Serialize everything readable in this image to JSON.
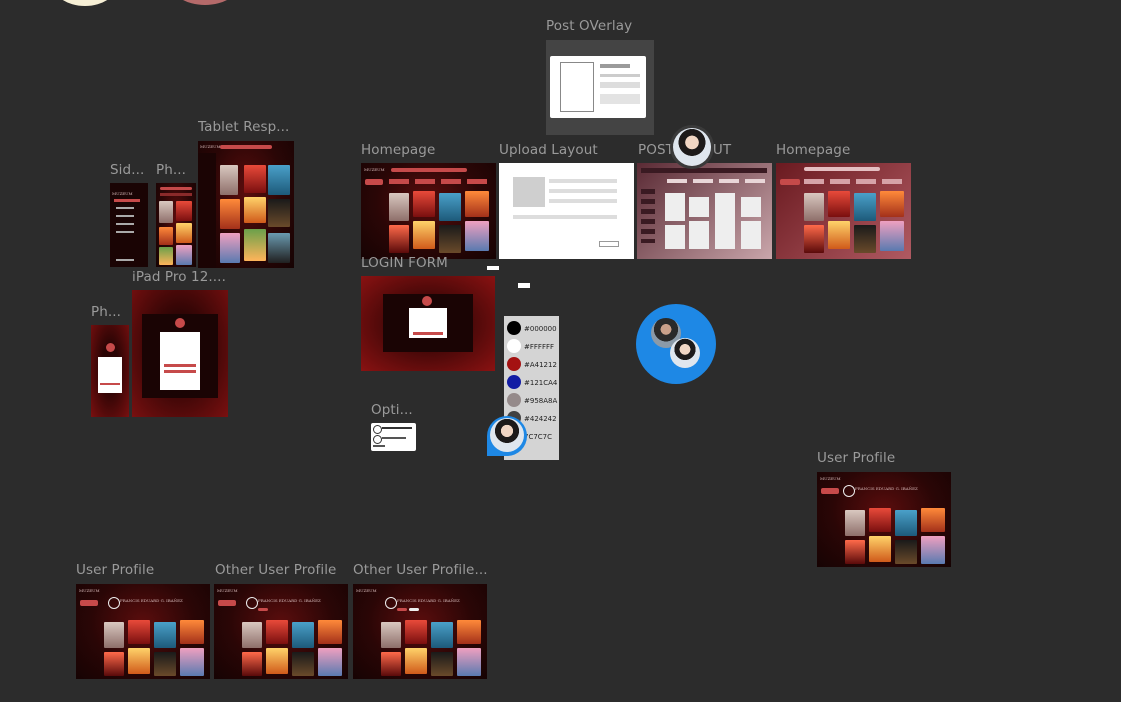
{
  "colors": {
    "canvas": "#2c2c2c",
    "frame_red_dark": "#2a0606",
    "accent": "#c64a4a",
    "label": "#9a9a9a",
    "multiplayer_blue": "#1e88e5"
  },
  "frames": {
    "post_overlay": "Post OVerlay",
    "tablet": "Tablet Resp...",
    "sidebar": "Sid...",
    "phone1": "Ph...",
    "homepage1": "Homepage",
    "upload_layout": "Upload Layout",
    "post_layout": "POST LAYOUT",
    "homepage2": "Homepage",
    "login_form": "LOGIN FORM",
    "ipad": "iPad Pro 12....",
    "phone2": "Ph...",
    "options": "Opti...",
    "user_profile_right": "User Profile",
    "user_profile_bottom": "User Profile",
    "other_user_profile": "Other User Profile",
    "other_user_profile2": "Other User Profile..."
  },
  "palette": [
    {
      "hex": "#000000",
      "label": "#000000"
    },
    {
      "hex": "#FFFFFF",
      "label": "#FFFFFF"
    },
    {
      "hex": "#A41212",
      "label": "#A41212"
    },
    {
      "hex": "#121CA4",
      "label": "#121CA4"
    },
    {
      "hex": "#958A8A",
      "label": "#958A8A"
    },
    {
      "hex": "#424242",
      "label": "#424242"
    },
    {
      "hex": "#7C7C7C",
      "label": "7C7C7C"
    }
  ],
  "mini": {
    "logo": "MUZEUM",
    "profile_name": "FRANCIS EDUARD G. IBAÑEZ",
    "login_title": "Log In to Muzeum"
  },
  "icons": [
    "user-avatar",
    "multiplayer-cursor-avatar"
  ]
}
